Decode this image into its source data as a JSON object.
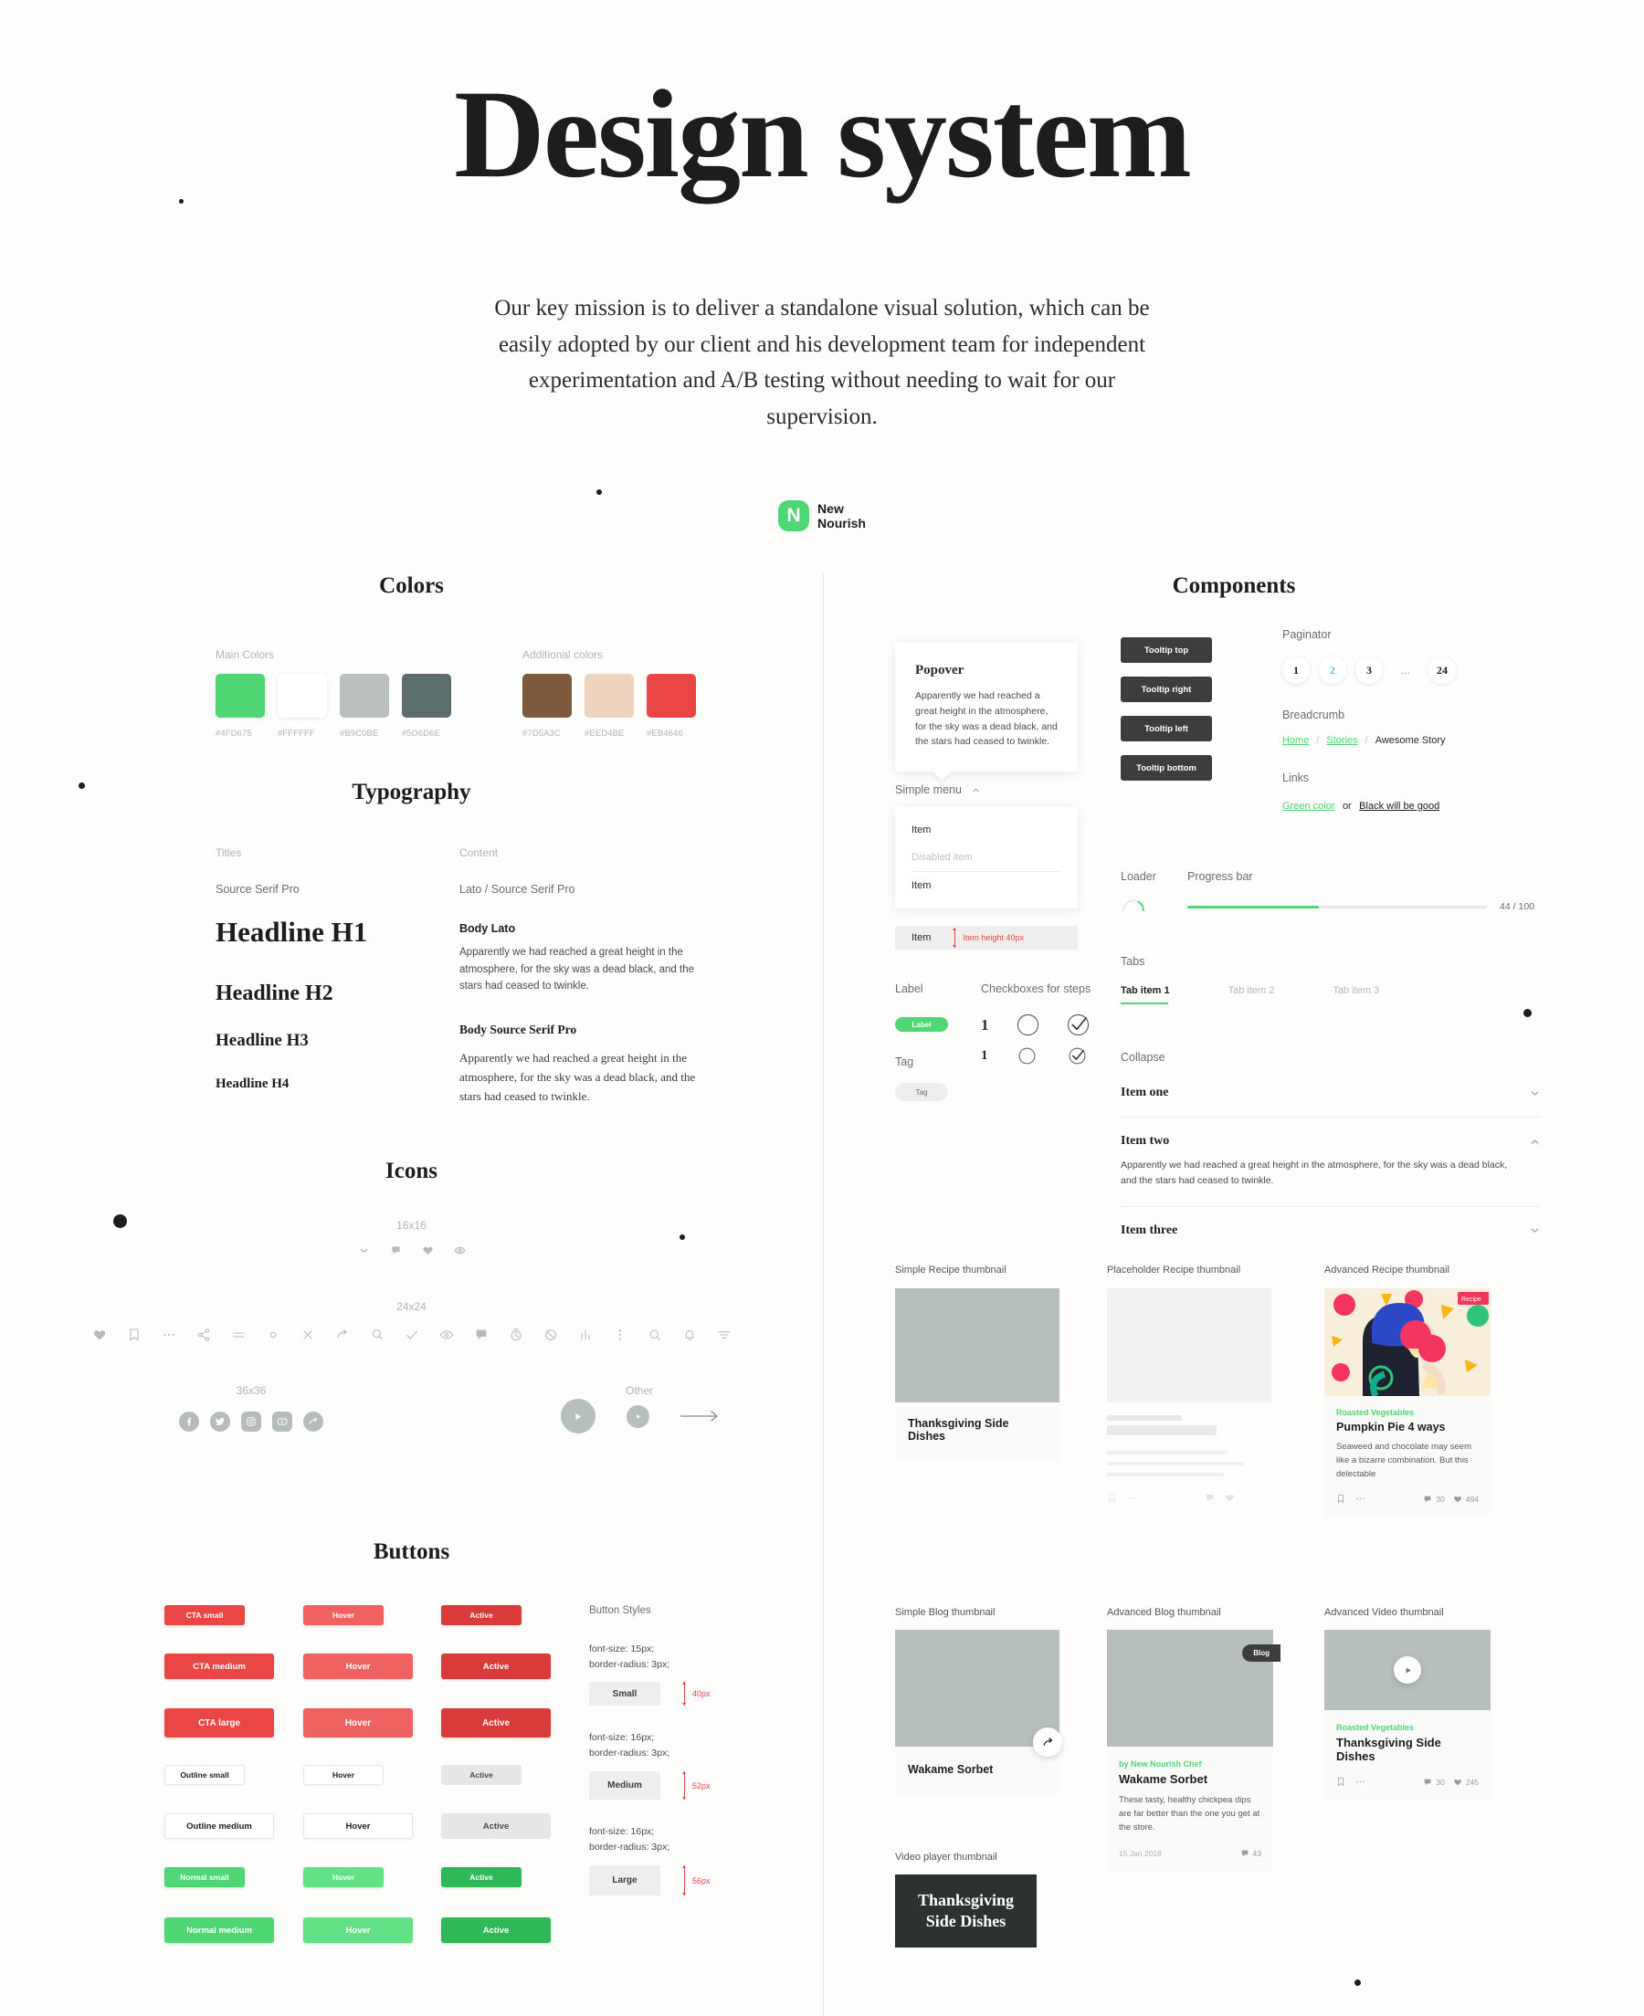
{
  "hero": {
    "title": "Design system",
    "subtitle": "Our key mission is to deliver a standalone visual solution, which can be easily adopted by our client and his development team for independent experimentation and A/B testing without needing to wait for our supervision.",
    "logo_mark": "N",
    "logo_line1": "New",
    "logo_line2": "Nourish"
  },
  "colors": {
    "section_title": "Colors",
    "main_label": "Main Colors",
    "additional_label": "Additional colors",
    "main": [
      {
        "hex": "#4FD675"
      },
      {
        "hex": "#FFFFFF"
      },
      {
        "hex": "#B9C0BE"
      },
      {
        "hex": "#5D6D6E"
      }
    ],
    "additional": [
      {
        "hex": "#7D5A3C"
      },
      {
        "hex": "#EED4BE"
      },
      {
        "hex": "#EB4646"
      }
    ]
  },
  "typography": {
    "section_title": "Typography",
    "titles_label": "Titles",
    "content_label": "Content",
    "titles_font": "Source Serif Pro",
    "content_font": "Lato / Source Serif Pro",
    "headlines": [
      "Headline H1",
      "Headline H2",
      "Headline H3",
      "Headline H4"
    ],
    "body_lato_head": "Body Lato",
    "body_lato_text": "Apparently we had reached a great height in the atmosphere, for the sky was a dead black, and the stars had ceased to twinkle.",
    "body_serif_head": "Body Source Serif Pro",
    "body_serif_text": "Apparently we had reached a great height in the atmosphere, for the sky was a dead black, and the stars had ceased to twinkle."
  },
  "icons": {
    "section_title": "Icons",
    "size_16": "16x16",
    "size_24": "24x24",
    "size_36": "36x36",
    "other": "Other",
    "set_16": [
      "chevron-down-icon",
      "comment-icon",
      "heart-icon",
      "eye-icon"
    ],
    "set_24": [
      "heart-icon",
      "bookmark-icon",
      "ellipsis-icon",
      "share-icon",
      "menu-icon",
      "circle-icon",
      "close-icon",
      "send-icon",
      "zoom-out-icon",
      "check-icon",
      "eye-icon",
      "comment-icon",
      "timer-icon",
      "no-icon",
      "chart-icon",
      "dots-vertical-icon",
      "search-icon",
      "bell-icon",
      "filter-icon"
    ],
    "set_36": [
      "facebook-icon",
      "twitter-icon",
      "instagram-icon",
      "youtube-icon",
      "share-icon"
    ],
    "set_other": [
      "play-large-icon",
      "play-small-icon",
      "arrow-right-icon"
    ]
  },
  "buttons": {
    "section_title": "Buttons",
    "rows": [
      {
        "base": "CTA small",
        "hover": "Hover",
        "active": "Active",
        "size": "small",
        "kind": "cta",
        "w": 88
      },
      {
        "base": "CTA medium",
        "hover": "Hover",
        "active": "Active",
        "size": "med",
        "kind": "cta",
        "w": 120
      },
      {
        "base": "CTA large",
        "hover": "Hover",
        "active": "Active",
        "size": "large",
        "kind": "cta",
        "w": 120
      },
      {
        "base": "Outline small",
        "hover": "Hover",
        "active": "Active",
        "size": "small",
        "kind": "outline",
        "w": 88
      },
      {
        "base": "Outline medium",
        "hover": "Hover",
        "active": "Active",
        "size": "med",
        "kind": "outline",
        "w": 120
      },
      {
        "base": "Normal small",
        "hover": "Hover",
        "active": "Active",
        "size": "small",
        "kind": "normal",
        "w": 88
      },
      {
        "base": "Normal medium",
        "hover": "Hover",
        "active": "Active",
        "size": "med",
        "kind": "normal",
        "w": 120
      }
    ],
    "styles_label": "Button Styles",
    "specs": [
      {
        "font": "font-size: 15px;",
        "radius": "border-radius: 3px;",
        "name": "Small",
        "dim": "40px",
        "h": 26
      },
      {
        "font": "font-size: 16px;",
        "radius": "border-radius: 3px;",
        "name": "Medium",
        "dim": "52px",
        "h": 31
      },
      {
        "font": "font-size: 16px;",
        "radius": "border-radius: 3px;",
        "name": "Large",
        "dim": "56px",
        "h": 33
      }
    ],
    "cta_base": "#EB4646",
    "cta_hover": "#F06161",
    "cta_active": "#D93A3A",
    "normal_base": "#4FD675",
    "normal_hover": "#62E186",
    "normal_active": "#2FB857"
  },
  "components": {
    "section_title": "Components",
    "popover": {
      "title": "Popover",
      "text": "Apparently we had reached a great height in the atmosphere, for the sky was a dead black, and the stars had ceased to twinkle."
    },
    "menu": {
      "label": "Simple menu",
      "items": [
        "Item",
        "Disabled item",
        "Item"
      ],
      "height_item": "Item",
      "height_note": "Item height 40px"
    },
    "label_section": {
      "label_title": "Label",
      "label_chip": "Label",
      "tag_title": "Tag",
      "tag_chip": "Tag"
    },
    "checkboxes": {
      "title": "Checkboxes for steps",
      "step_1": "1",
      "step_2": "1"
    },
    "tooltips": [
      "Tooltip top",
      "Tooltip right",
      "Tooltip left",
      "Tooltip bottom"
    ],
    "paginator": {
      "label": "Paginator",
      "pages": [
        "1",
        "2",
        "3",
        "...",
        "24"
      ],
      "current": "2"
    },
    "breadcrumb": {
      "label": "Breadcrumb",
      "items": [
        "Home",
        "Stories",
        "Awesome Story"
      ],
      "separator": "/"
    },
    "links": {
      "label": "Links",
      "green": "Green color",
      "middle": "or",
      "black": "Black will be good"
    },
    "loader_label": "Loader",
    "progress": {
      "label": "Progress bar",
      "value": 44,
      "max": 100,
      "text": "44 / 100"
    },
    "tabs": {
      "label": "Tabs",
      "items": [
        "Tab item 1",
        "Tab item 2",
        "Tab item 3"
      ],
      "active": "Tab item 1"
    },
    "collapse": {
      "label": "Collapse",
      "items": [
        {
          "title": "Item one",
          "open": false,
          "body": ""
        },
        {
          "title": "Item two",
          "open": true,
          "body": "Apparently we had reached a great height in the atmosphere, for the sky was a dead black, and the stars had ceased to twinkle."
        },
        {
          "title": "Item three",
          "open": false,
          "body": ""
        }
      ]
    }
  },
  "thumbnails": {
    "simple_recipe": {
      "label": "Simple Recipe thumbnail",
      "title": "Thanksgiving Side Dishes"
    },
    "placeholder_recipe": {
      "label": "Placeholder Recipe thumbnail"
    },
    "advanced_recipe": {
      "label": "Advanced Recipe thumbnail",
      "category": "Roasted Vegetables",
      "title": "Pumpkin Pie 4 ways",
      "body": "Seaweed and chocolate may seem like a bizarre combination. But this delectable",
      "comments": "30",
      "likes": "494"
    },
    "simple_blog": {
      "label": "Simple Blog thumbnail",
      "title": "Wakame Sorbet"
    },
    "advanced_blog": {
      "label": "Advanced Blog thumbnail",
      "badge": "Blog",
      "author": "by New Nourish Chef",
      "title": "Wakame Sorbet",
      "body": "These tasty, healthy chickpea dips are far better than the one you get at the store.",
      "date": "15 Jan 2018",
      "comments": "43"
    },
    "advanced_video": {
      "label": "Advanced Video thumbnail",
      "category": "Roasted Vegetables",
      "title": "Thanksgiving Side Dishes",
      "comments": "30",
      "likes": "245"
    },
    "video_player": {
      "label": "Video player thumbnail",
      "title_line1": "Thanksgiving",
      "title_line2": "Side Dishes"
    }
  }
}
